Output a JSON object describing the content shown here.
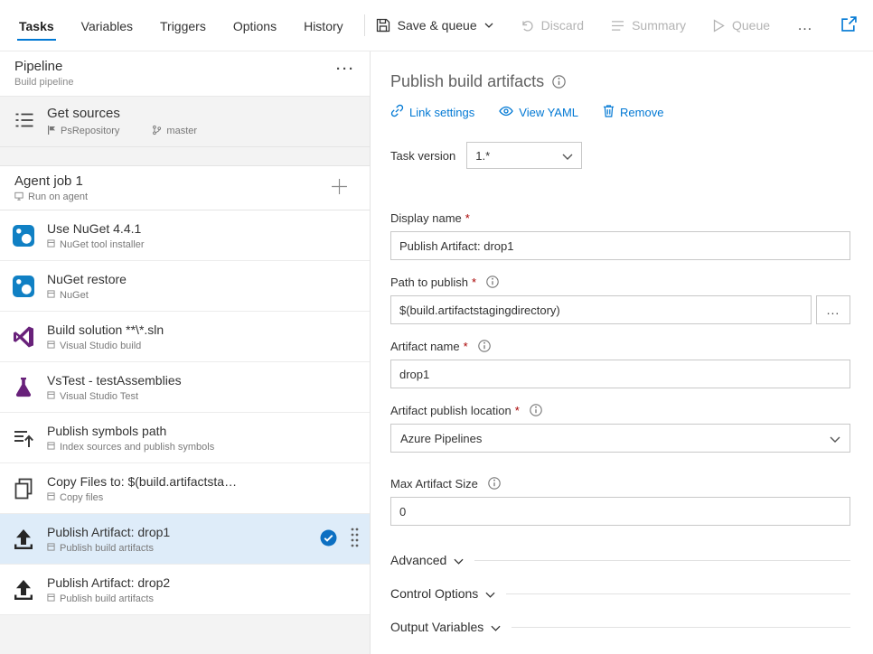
{
  "topbar": {
    "tabs": [
      "Tasks",
      "Variables",
      "Triggers",
      "Options",
      "History"
    ],
    "save_queue": "Save & queue",
    "discard": "Discard",
    "summary": "Summary",
    "queue": "Queue",
    "more": "…"
  },
  "left": {
    "pipeline": {
      "title": "Pipeline",
      "subtitle": "Build pipeline",
      "more": "···"
    },
    "get_sources": {
      "title": "Get sources",
      "repo": "PsRepository",
      "branch": "master"
    },
    "agent_job": {
      "title": "Agent job 1",
      "subtitle": "Run on agent"
    },
    "tasks": [
      {
        "title": "Use NuGet 4.4.1",
        "subtitle": "NuGet tool installer",
        "icon": "nuget"
      },
      {
        "title": "NuGet restore",
        "subtitle": "NuGet",
        "icon": "nuget"
      },
      {
        "title": "Build solution **\\*.sln",
        "subtitle": "Visual Studio build",
        "icon": "visual-studio"
      },
      {
        "title": "VsTest - testAssemblies",
        "subtitle": "Visual Studio Test",
        "icon": "test-flask"
      },
      {
        "title": "Publish symbols path",
        "subtitle": "Index sources and publish symbols",
        "icon": "symbols"
      },
      {
        "title": "Copy Files to: $(build.artifactsta…",
        "subtitle": "Copy files",
        "icon": "copy-files"
      },
      {
        "title": "Publish Artifact: drop1",
        "subtitle": "Publish build artifacts",
        "icon": "publish-artifact",
        "selected": true
      },
      {
        "title": "Publish Artifact: drop2",
        "subtitle": "Publish build artifacts",
        "icon": "publish-artifact"
      }
    ]
  },
  "detail": {
    "title": "Publish build artifacts",
    "links": {
      "link_settings": "Link settings",
      "view_yaml": "View YAML",
      "remove": "Remove"
    },
    "task_version": {
      "label": "Task version",
      "value": "1.*"
    },
    "required_marker": "*",
    "fields": {
      "display_name": {
        "label": "Display name",
        "value": "Publish Artifact: drop1"
      },
      "path_to_publish": {
        "label": "Path to publish",
        "value": "$(build.artifactstagingdirectory)",
        "browse": "..."
      },
      "artifact_name": {
        "label": "Artifact name",
        "value": "drop1"
      },
      "publish_location": {
        "label": "Artifact publish location",
        "value": "Azure Pipelines"
      },
      "max_artifact_size": {
        "label": "Max Artifact Size",
        "value": "0"
      }
    },
    "sections": [
      "Advanced",
      "Control Options",
      "Output Variables"
    ]
  },
  "colors": {
    "accent": "#0078d4",
    "selected_bg": "#deecf9",
    "required": "#a80000"
  }
}
